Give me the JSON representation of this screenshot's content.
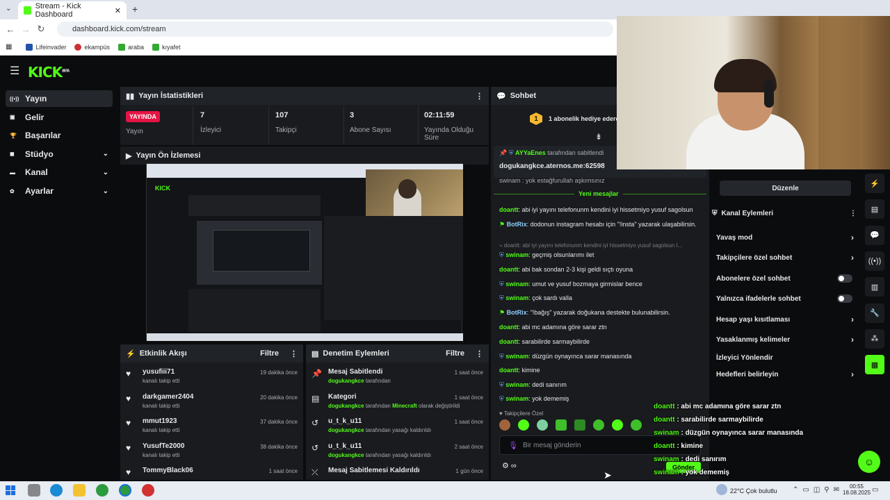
{
  "browser": {
    "tab_title": "Stream - Kick Dashboard",
    "url": "dashboard.kick.com/stream",
    "bookmarks": [
      "Lifeinvader",
      "ekampüs",
      "araba",
      "kıyafet"
    ]
  },
  "logo": "KICK",
  "logo_sup": "BETA",
  "sidebar": {
    "items": [
      {
        "label": "Yayın",
        "icon": "broadcast-icon",
        "active": true
      },
      {
        "label": "Gelir",
        "icon": "wallet-icon"
      },
      {
        "label": "Başarılar",
        "icon": "trophy-icon"
      },
      {
        "label": "Stüdyo",
        "icon": "studio-icon",
        "chevron": true
      },
      {
        "label": "Kanal",
        "icon": "channel-icon",
        "chevron": true
      },
      {
        "label": "Ayarlar",
        "icon": "gear-icon",
        "chevron": true
      }
    ]
  },
  "stats": {
    "title": "Yayın İstatistikleri",
    "live_badge": "YAYINDA",
    "live_label": "Yayın",
    "items": [
      {
        "value": "7",
        "label": "İzleyici"
      },
      {
        "value": "107",
        "label": "Takipçi"
      },
      {
        "value": "3",
        "label": "Abone Sayısı"
      },
      {
        "value": "02:11:59",
        "label": "Yayında Olduğu Süre"
      }
    ]
  },
  "preview": {
    "title": "Yayın Ön İzlemesi"
  },
  "activity": {
    "title": "Etkinlik Akışı",
    "filter": "Filtre",
    "items": [
      {
        "name": "yusufiii71",
        "sub": "kanalı takip etti",
        "time": "19 dakika önce"
      },
      {
        "name": "darkgamer2404",
        "sub": "kanalı takip etti",
        "time": "20 dakika önce"
      },
      {
        "name": "mmut1923",
        "sub": "kanalı takip etti",
        "time": "37 dakika önce"
      },
      {
        "name": "YusufTe2000",
        "sub": "kanalı takip etti",
        "time": "38 dakika önce"
      },
      {
        "name": "TommyBlack06",
        "sub": "",
        "time": "1 saat önce"
      }
    ]
  },
  "moderation": {
    "title": "Denetim Eylemleri",
    "filter": "Filtre",
    "items": [
      {
        "title": "Mesaj Sabitlendi",
        "user": "dogukangkce",
        "rest": "tarafından",
        "game": "",
        "rest2": "",
        "time": "1 saat önce",
        "icon": "pin-icon"
      },
      {
        "title": "Kategori",
        "user": "dogukangkce",
        "rest": "tarafından",
        "game": "Minecraft",
        "rest2": "olarak değiştirildi",
        "time": "1 saat önce",
        "icon": "category-icon"
      },
      {
        "title": "u_t_k_u11",
        "user": "dogukangkce",
        "rest": "tarafından yasağı kaldırıldı",
        "game": "",
        "rest2": "",
        "time": "1 saat önce",
        "icon": "undo-icon"
      },
      {
        "title": "u_t_k_u11",
        "user": "dogukangkce",
        "rest": "tarafından yasağı kaldırıldı",
        "game": "",
        "rest2": "",
        "time": "2 saat önce",
        "icon": "undo-icon"
      },
      {
        "title": "Mesaj Sabitlemesi Kaldırıldı",
        "user": "",
        "rest": "",
        "game": "",
        "rest2": "",
        "time": "1 gün önce",
        "icon": "unpin-icon"
      }
    ]
  },
  "chat": {
    "title": "Sohbet",
    "gift_text": "1 abonelik hediye edere",
    "gift_count": "1",
    "pinned_by_user": "AYYaEnes",
    "pinned_by_text": "tarafından sabitlendi",
    "pinned_message": "dogukangkce.aternos.me:62598",
    "partial_top": "swinam : yok estağfurullah aşkımsınız",
    "new_messages": "Yeni mesajlar",
    "messages": [
      {
        "user": "doantt",
        "text": "abi iyi yayını telefonunm kendini iyi hissetmiyo yusuf sagolsun",
        "type": "user"
      },
      {
        "user": "BotRix",
        "text": "dodonun instagram hesabı için \"!insta\" yazarak ulaşabilirsin.",
        "type": "bot"
      },
      {
        "user": "",
        "text": "doantt: abi iyi yayını telefonunm kendini iyi hissetmiyo yusuf sagolsun I...",
        "type": "reply"
      },
      {
        "user": "swinam",
        "text": "geçmiş olsunlarımı ilet",
        "type": "mod"
      },
      {
        "user": "doantt",
        "text": "abi bak sondan 2-3 kişi geldi sıçtı oyuna",
        "type": "user"
      },
      {
        "user": "swinam",
        "text": "umut ve yusuf bozmaya girmislar bence",
        "type": "mod"
      },
      {
        "user": "swinam",
        "text": "çok sardı valla",
        "type": "mod"
      },
      {
        "user": "BotRix",
        "text": "\"!bağış\" yazarak doğukana destekte bulunabilirsin.",
        "type": "bot"
      },
      {
        "user": "doantt",
        "text": "abi mc adamına göre sarar ztn",
        "type": "user"
      },
      {
        "user": "doantt",
        "text": "sarabilirde sarmaybilirde",
        "type": "user"
      },
      {
        "user": "swinam",
        "text": "düzgün oynayınca sarar manasında",
        "type": "mod"
      },
      {
        "user": "doantt",
        "text": "kimine",
        "type": "user"
      },
      {
        "user": "swinam",
        "text": "dedi sanırım",
        "type": "mod"
      },
      {
        "user": "swinam",
        "text": "yok dememiş",
        "type": "mod"
      }
    ],
    "followers_only": "Takipçilere Özel",
    "input_placeholder": "Bir mesaj gönderin",
    "send_label": "Gönder"
  },
  "right_panel": {
    "edit_label": "Düzenle",
    "title": "Kanal Eylemleri",
    "items": [
      {
        "label": "Yavaş mod",
        "control": "arrow"
      },
      {
        "label": "Takipçilere özel sohbet",
        "control": "arrow"
      },
      {
        "label": "Abonelere özel sohbet",
        "control": "toggle"
      },
      {
        "label": "Yalnızca ifadelerle sohbet",
        "control": "toggle"
      },
      {
        "label": "Hesap yaşı kısıtlaması",
        "control": "arrow"
      },
      {
        "label": "Yasaklanmış kelimeler",
        "control": "arrow"
      },
      {
        "label": "İzleyici Yönlendir",
        "control": "none"
      },
      {
        "label": "Hedefleri belirleyin",
        "control": "arrow"
      }
    ]
  },
  "overlay_chat": [
    {
      "user": "doantt",
      "text": ": abi mc adamına göre sarar ztn"
    },
    {
      "user": "doantt",
      "text": ": sarabilirde sarmaybilirde"
    },
    {
      "user": "swinam",
      "text": ": düzgün oynayınca sarar manasında"
    },
    {
      "user": "doantt",
      "text": ": kimine"
    },
    {
      "user": "swinam",
      "text": ": dedi sanırım"
    },
    {
      "user": "swinam",
      "text": ": yok dememiş"
    }
  ],
  "taskbar": {
    "weather": "22°C  Çok bulutlu",
    "time": "00:55",
    "date": "18.08.2025"
  },
  "colors": {
    "accent": "#53fc18",
    "live": "#e51444",
    "bg": "#0b0c0e",
    "panel": "#191b1f"
  }
}
